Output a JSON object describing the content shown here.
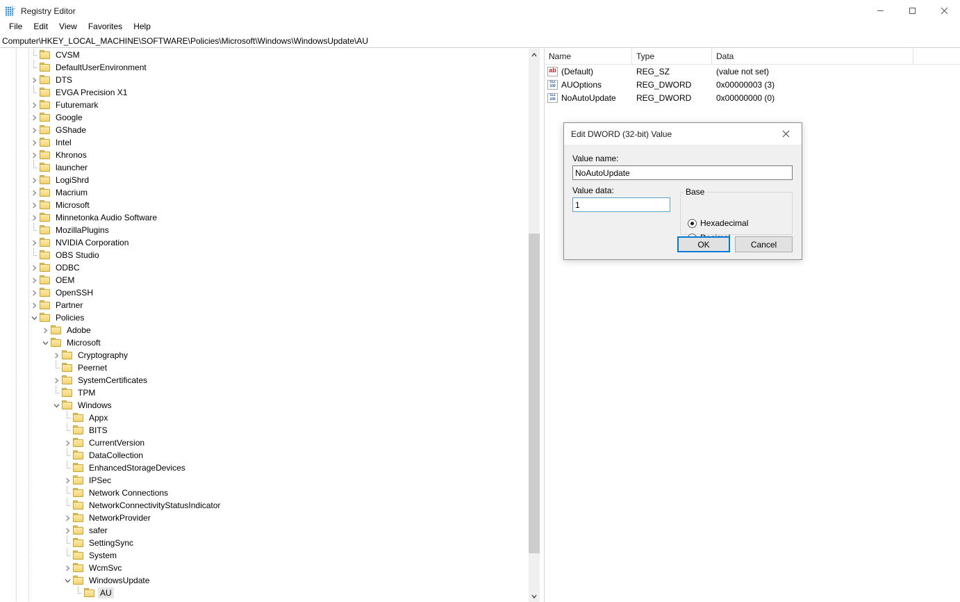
{
  "window": {
    "title": "Registry Editor",
    "icon": "registry-editor-icon",
    "controls": {
      "minimize": "minimize-icon",
      "maximize": "maximize-icon",
      "close": "close-icon"
    }
  },
  "menubar": {
    "items": [
      "File",
      "Edit",
      "View",
      "Favorites",
      "Help"
    ]
  },
  "address": {
    "path": "Computer\\HKEY_LOCAL_MACHINE\\SOFTWARE\\Policies\\Microsoft\\Windows\\WindowsUpdate\\AU"
  },
  "tree": {
    "nodes": [
      {
        "label": "CVSM",
        "indent": 1,
        "expander": "none",
        "selected": false
      },
      {
        "label": "DefaultUserEnvironment",
        "indent": 1,
        "expander": "none",
        "selected": false
      },
      {
        "label": "DTS",
        "indent": 1,
        "expander": "collapsed",
        "selected": false
      },
      {
        "label": "EVGA Precision X1",
        "indent": 1,
        "expander": "none",
        "selected": false
      },
      {
        "label": "Futuremark",
        "indent": 1,
        "expander": "collapsed",
        "selected": false
      },
      {
        "label": "Google",
        "indent": 1,
        "expander": "collapsed",
        "selected": false
      },
      {
        "label": "GShade",
        "indent": 1,
        "expander": "collapsed",
        "selected": false
      },
      {
        "label": "Intel",
        "indent": 1,
        "expander": "collapsed",
        "selected": false
      },
      {
        "label": "Khronos",
        "indent": 1,
        "expander": "collapsed",
        "selected": false
      },
      {
        "label": "launcher",
        "indent": 1,
        "expander": "none",
        "selected": false
      },
      {
        "label": "LogiShrd",
        "indent": 1,
        "expander": "collapsed",
        "selected": false
      },
      {
        "label": "Macrium",
        "indent": 1,
        "expander": "collapsed",
        "selected": false
      },
      {
        "label": "Microsoft",
        "indent": 1,
        "expander": "collapsed",
        "selected": false
      },
      {
        "label": "Minnetonka Audio Software",
        "indent": 1,
        "expander": "collapsed",
        "selected": false
      },
      {
        "label": "MozillaPlugins",
        "indent": 1,
        "expander": "none",
        "selected": false
      },
      {
        "label": "NVIDIA Corporation",
        "indent": 1,
        "expander": "collapsed",
        "selected": false
      },
      {
        "label": "OBS Studio",
        "indent": 1,
        "expander": "none",
        "selected": false
      },
      {
        "label": "ODBC",
        "indent": 1,
        "expander": "collapsed",
        "selected": false
      },
      {
        "label": "OEM",
        "indent": 1,
        "expander": "collapsed",
        "selected": false
      },
      {
        "label": "OpenSSH",
        "indent": 1,
        "expander": "collapsed",
        "selected": false
      },
      {
        "label": "Partner",
        "indent": 1,
        "expander": "collapsed",
        "selected": false
      },
      {
        "label": "Policies",
        "indent": 1,
        "expander": "expanded",
        "selected": false
      },
      {
        "label": "Adobe",
        "indent": 2,
        "expander": "collapsed",
        "selected": false
      },
      {
        "label": "Microsoft",
        "indent": 2,
        "expander": "expanded",
        "selected": false
      },
      {
        "label": "Cryptography",
        "indent": 3,
        "expander": "collapsed",
        "selected": false
      },
      {
        "label": "Peernet",
        "indent": 3,
        "expander": "none",
        "selected": false
      },
      {
        "label": "SystemCertificates",
        "indent": 3,
        "expander": "collapsed",
        "selected": false
      },
      {
        "label": "TPM",
        "indent": 3,
        "expander": "none",
        "selected": false
      },
      {
        "label": "Windows",
        "indent": 3,
        "expander": "expanded",
        "selected": false
      },
      {
        "label": "Appx",
        "indent": 4,
        "expander": "none",
        "selected": false
      },
      {
        "label": "BITS",
        "indent": 4,
        "expander": "none",
        "selected": false
      },
      {
        "label": "CurrentVersion",
        "indent": 4,
        "expander": "collapsed",
        "selected": false
      },
      {
        "label": "DataCollection",
        "indent": 4,
        "expander": "none",
        "selected": false
      },
      {
        "label": "EnhancedStorageDevices",
        "indent": 4,
        "expander": "none",
        "selected": false
      },
      {
        "label": "IPSec",
        "indent": 4,
        "expander": "collapsed",
        "selected": false
      },
      {
        "label": "Network Connections",
        "indent": 4,
        "expander": "none",
        "selected": false
      },
      {
        "label": "NetworkConnectivityStatusIndicator",
        "indent": 4,
        "expander": "none",
        "selected": false
      },
      {
        "label": "NetworkProvider",
        "indent": 4,
        "expander": "collapsed",
        "selected": false
      },
      {
        "label": "safer",
        "indent": 4,
        "expander": "collapsed",
        "selected": false
      },
      {
        "label": "SettingSync",
        "indent": 4,
        "expander": "none",
        "selected": false
      },
      {
        "label": "System",
        "indent": 4,
        "expander": "none",
        "selected": false
      },
      {
        "label": "WcmSvc",
        "indent": 4,
        "expander": "collapsed",
        "selected": false
      },
      {
        "label": "WindowsUpdate",
        "indent": 4,
        "expander": "expanded",
        "selected": false
      },
      {
        "label": "AU",
        "indent": 5,
        "expander": "none",
        "selected": true
      }
    ]
  },
  "values": {
    "columns": [
      "Name",
      "Type",
      "Data",
      ""
    ],
    "rows": [
      {
        "icon": "string-value-icon",
        "name": "(Default)",
        "type": "REG_SZ",
        "data": "(value not set)"
      },
      {
        "icon": "dword-value-icon",
        "name": "AUOptions",
        "type": "REG_DWORD",
        "data": "0x00000003 (3)"
      },
      {
        "icon": "dword-value-icon",
        "name": "NoAutoUpdate",
        "type": "REG_DWORD",
        "data": "0x00000000 (0)"
      }
    ]
  },
  "dialog": {
    "title": "Edit DWORD (32-bit) Value",
    "close_icon": "close-icon",
    "value_name_label": "Value name:",
    "value_name": "NoAutoUpdate",
    "value_data_label": "Value data:",
    "value_data": "1",
    "base_legend": "Base",
    "base_options": [
      {
        "label": "Hexadecimal",
        "selected": true
      },
      {
        "label": "Decimal",
        "selected": false
      }
    ],
    "ok_label": "OK",
    "cancel_label": "Cancel"
  },
  "scrollbar": {
    "up_icon": "chevron-up-icon",
    "down_icon": "chevron-down-icon"
  },
  "colors": {
    "accent": "#0078d7",
    "folder": "#f0d373",
    "selection": "#e6e6e6"
  }
}
